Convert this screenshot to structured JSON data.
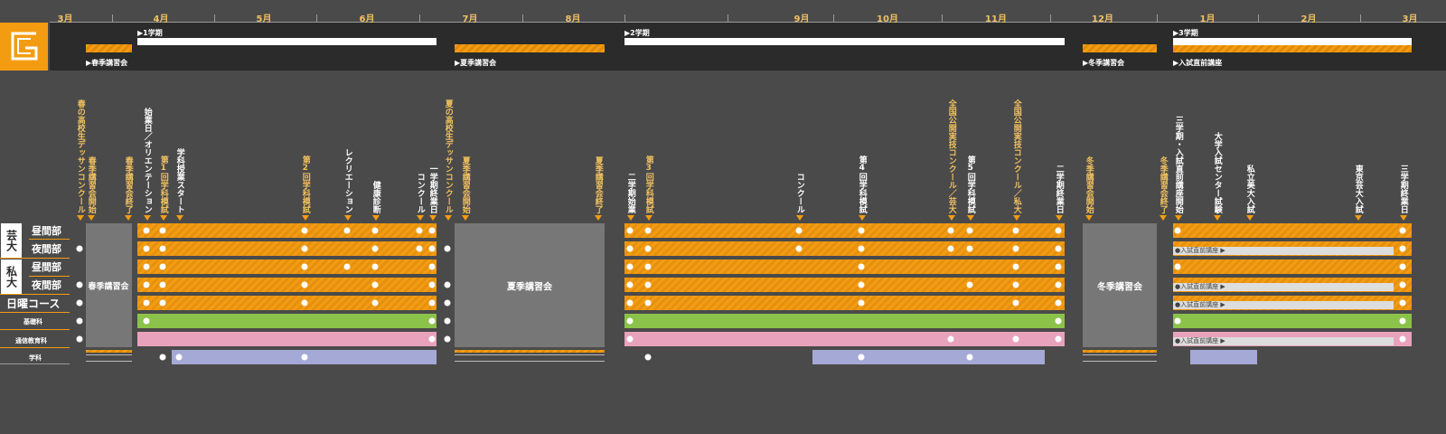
{
  "timeline": {
    "months": [
      "3月",
      "4月",
      "5月",
      "6月",
      "7月",
      "8月",
      "9月",
      "10月",
      "11月",
      "12月",
      "1月",
      "2月",
      "3月"
    ]
  },
  "header": {
    "logo_icon": "g-logo-icon",
    "terms": [
      "1学期",
      "2学期",
      "3学期"
    ],
    "courses": [
      "春季講習会",
      "夏季講習会",
      "冬季講習会",
      "入試直前講座"
    ]
  },
  "events": [
    "春の高校生デッサンコンクール",
    "春季講習会開始",
    "春季講習会終了",
    "始業日／オリエンテーション",
    "第1回学科模試",
    "学科授業スタート",
    "第2回学科模試",
    "レクリエーション",
    "健康診断",
    "コンクール",
    "一学期終業日",
    "夏の高校生デッサンコンクール",
    "夏季講習会開始",
    "夏季講習会終了",
    "二学期始業",
    "第3回学科模試",
    "コンクール",
    "第4回学科模試",
    "全国公開実技コンクール／芸大",
    "第5回学科模試",
    "全国公開実技コンクール／私大",
    "二学期終業日",
    "冬季講習会開始",
    "冬季講習会終了",
    "三学期・入試直前講座開始",
    "大学入試センター試験",
    "私立美大入試",
    "東京芸大入試",
    "三学期終業日"
  ],
  "sidebar": {
    "geidai": "芸大",
    "shidai": "私大",
    "day": "昼間部",
    "night": "夜間部",
    "sunday": "日曜コース",
    "basic": "基礎科",
    "correspondence": "通信教育科",
    "academic": "学科"
  },
  "blocks": {
    "spring": "春季講習会",
    "summer": "夏季講習会",
    "winter": "冬季講習会",
    "preexam": "●入試直前講座 ▶"
  },
  "colors": {
    "background": "#4a4a4a",
    "header": "#2b2b2b",
    "orange": "#f39c12",
    "green": "#8bc34a",
    "pink": "#e8a2bb",
    "lavender": "#a4a9d6",
    "gray_block": "#777777",
    "event_text": "#f0c060"
  }
}
